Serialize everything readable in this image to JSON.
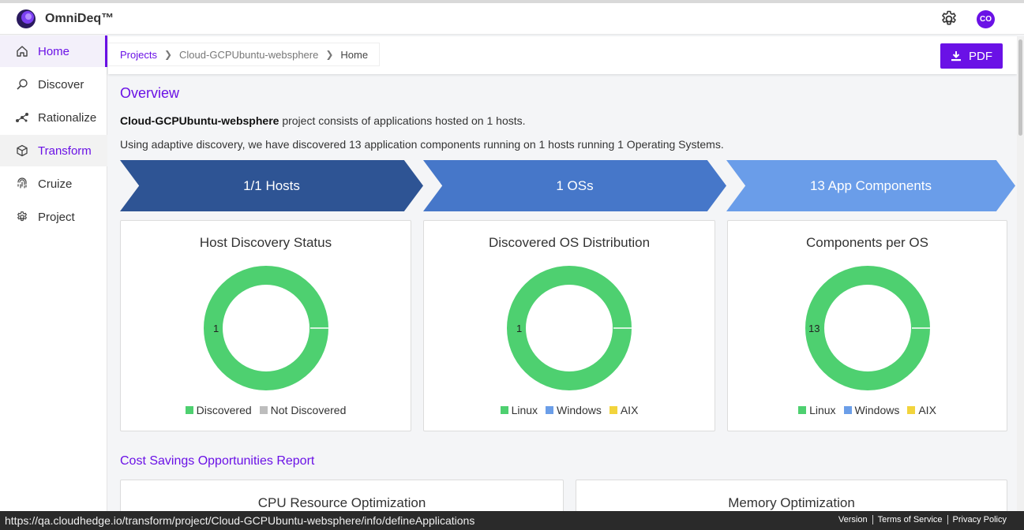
{
  "app": {
    "brand": "OmniDeq™",
    "avatar_initials": "CO",
    "accent": "#6a11e6"
  },
  "sidebar": {
    "items": [
      {
        "label": "Home",
        "icon": "home-icon"
      },
      {
        "label": "Discover",
        "icon": "discover-icon"
      },
      {
        "label": "Rationalize",
        "icon": "rationalize-icon"
      },
      {
        "label": "Transform",
        "icon": "transform-cube-icon"
      },
      {
        "label": "Cruize",
        "icon": "fingerprint-icon"
      },
      {
        "label": "Project",
        "icon": "settings-icon"
      }
    ]
  },
  "breadcrumb": {
    "items": [
      "Projects",
      "Cloud-GCPUbuntu-websphere",
      "Home"
    ]
  },
  "toolbar": {
    "pdf_label": "PDF"
  },
  "overview": {
    "heading": "Overview",
    "project_name": "Cloud-GCPUbuntu-websphere",
    "line1_rest": " project consists of applications hosted on 1 hosts.",
    "line2": "Using adaptive discovery, we have discovered 13 application components running on 1 hosts running 1 Operating Systems."
  },
  "summary_arrows": [
    {
      "label": "1/1 Hosts",
      "color": "#2e5494"
    },
    {
      "label": "1 OSs",
      "color": "#4677c9"
    },
    {
      "label": "13 App Components",
      "color": "#6a9de9"
    }
  ],
  "cards": [
    {
      "title": "Host Discovery Status",
      "center_label": "1",
      "legend": [
        {
          "label": "Discovered",
          "color": "#4ed070"
        },
        {
          "label": "Not Discovered",
          "color": "#bdbdbd"
        }
      ]
    },
    {
      "title": "Discovered OS Distribution",
      "center_label": "1",
      "legend": [
        {
          "label": "Linux",
          "color": "#4ed070"
        },
        {
          "label": "Windows",
          "color": "#6b9ee8"
        },
        {
          "label": "AIX",
          "color": "#f2d43c"
        }
      ]
    },
    {
      "title": "Components per OS",
      "center_label": "13",
      "legend": [
        {
          "label": "Linux",
          "color": "#4ed070"
        },
        {
          "label": "Windows",
          "color": "#6b9ee8"
        },
        {
          "label": "AIX",
          "color": "#f2d43c"
        }
      ]
    }
  ],
  "cost": {
    "heading": "Cost Savings Opportunities Report",
    "cards": [
      "CPU Resource Optimization",
      "Memory Optimization"
    ]
  },
  "statusbar": {
    "url": "https://qa.cloudhedge.io/transform/project/Cloud-GCPUbuntu-websphere/info/defineApplications",
    "links": [
      "Version",
      "Terms of Service",
      "Privacy Policy"
    ]
  }
}
